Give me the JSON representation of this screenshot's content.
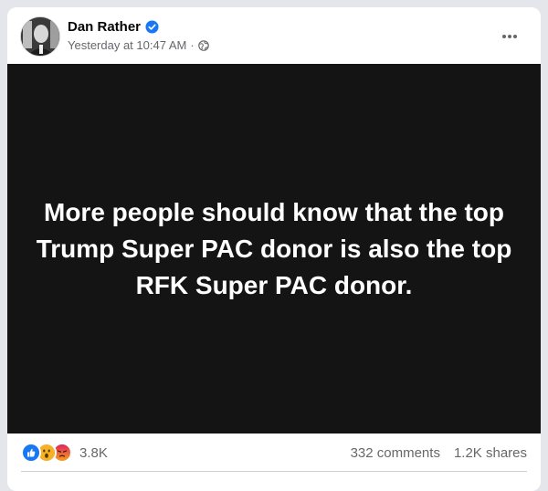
{
  "post": {
    "author": "Dan Rather",
    "timestamp": "Yesterday at 10:47 AM",
    "separator": "·",
    "audience_icon": "globe-icon",
    "verified_icon": "verified-badge-icon",
    "more_icon": "more-options-icon",
    "body_text": "More people should know that the top Trump Super PAC donor is also the top RFK Super PAC donor."
  },
  "stats": {
    "reactions": [
      "like",
      "wow",
      "angry"
    ],
    "reaction_count": "3.8K",
    "comments": "332 comments",
    "shares": "1.2K shares"
  },
  "colors": {
    "verified": "#1877f2",
    "like": "#1877f2",
    "wow": "#f7b125",
    "angry": "#e9710f",
    "image_bg": "#141414"
  }
}
